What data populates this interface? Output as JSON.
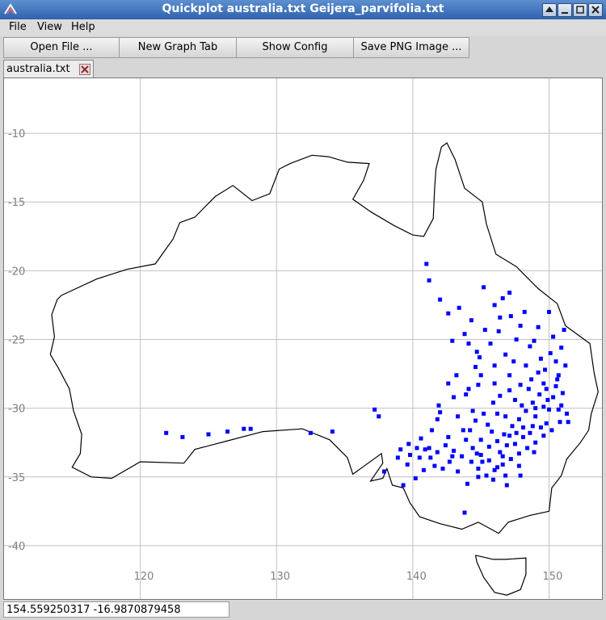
{
  "window": {
    "title": "Quickplot australia.txt Geijera_parvifolia.txt"
  },
  "menu": [
    "File",
    "View",
    "Help"
  ],
  "toolbar": {
    "open_file": "Open File ...",
    "new_graph_tab": "New Graph Tab",
    "show_config": "Show Config",
    "save_png": "Save PNG Image ..."
  },
  "tab": {
    "label": "australia.txt"
  },
  "status": {
    "coords": "154.559250317  -16.9870879458"
  },
  "colors": {
    "points": "#0000ff",
    "outline": "#000000",
    "grid": "#c0c0c0",
    "tick_text": "#808080"
  },
  "chart_data": {
    "type": "scatter",
    "xlim": [
      110,
      154
    ],
    "ylim": [
      -44,
      -6
    ],
    "xticks": [
      120,
      130,
      140,
      150
    ],
    "xtick_labels": [
      "120",
      "130",
      "140",
      "150"
    ],
    "yticks": [
      -10,
      -15,
      -20,
      -25,
      -30,
      -35,
      -40
    ],
    "ytick_labels": [
      "-10",
      "-15",
      "-20",
      "-25",
      "-30",
      "-35",
      "-40"
    ],
    "grid": true,
    "series": [
      {
        "marker": "outline-line",
        "points": [
          [
            114.2,
            -21.8
          ],
          [
            116.8,
            -20.6
          ],
          [
            119.0,
            -19.9
          ],
          [
            121.1,
            -19.5
          ],
          [
            122.4,
            -17.7
          ],
          [
            122.9,
            -16.5
          ],
          [
            124.0,
            -16.1
          ],
          [
            125.5,
            -14.6
          ],
          [
            126.8,
            -13.8
          ],
          [
            128.2,
            -14.9
          ],
          [
            129.5,
            -14.4
          ],
          [
            130.2,
            -12.6
          ],
          [
            131.0,
            -12.2
          ],
          [
            132.6,
            -11.6
          ],
          [
            133.8,
            -11.7
          ],
          [
            135.2,
            -12.1
          ],
          [
            136.8,
            -12.2
          ],
          [
            136.4,
            -13.4
          ],
          [
            135.6,
            -14.8
          ],
          [
            136.9,
            -15.7
          ],
          [
            138.6,
            -16.7
          ],
          [
            140.0,
            -17.4
          ],
          [
            140.8,
            -17.5
          ],
          [
            141.5,
            -16.2
          ],
          [
            141.6,
            -14.0
          ],
          [
            141.7,
            -12.6
          ],
          [
            142.1,
            -11.0
          ],
          [
            142.5,
            -10.7
          ],
          [
            143.1,
            -11.9
          ],
          [
            143.8,
            -14.0
          ],
          [
            145.1,
            -15.0
          ],
          [
            145.4,
            -16.6
          ],
          [
            146.1,
            -18.8
          ],
          [
            147.6,
            -19.7
          ],
          [
            149.2,
            -21.3
          ],
          [
            150.6,
            -22.4
          ],
          [
            151.2,
            -24.0
          ],
          [
            153.0,
            -25.3
          ],
          [
            153.3,
            -27.4
          ],
          [
            153.6,
            -28.8
          ],
          [
            153.1,
            -30.4
          ],
          [
            152.9,
            -31.6
          ],
          [
            152.3,
            -32.5
          ],
          [
            151.3,
            -33.7
          ],
          [
            150.9,
            -34.9
          ],
          [
            150.2,
            -35.8
          ],
          [
            150.0,
            -37.5
          ],
          [
            148.6,
            -37.8
          ],
          [
            147.0,
            -38.3
          ],
          [
            146.3,
            -39.1
          ],
          [
            144.8,
            -38.3
          ],
          [
            143.6,
            -38.8
          ],
          [
            142.0,
            -38.4
          ],
          [
            140.5,
            -37.9
          ],
          [
            139.8,
            -36.9
          ],
          [
            139.3,
            -35.8
          ],
          [
            138.5,
            -35.6
          ],
          [
            138.1,
            -34.4
          ],
          [
            137.8,
            -35.1
          ],
          [
            136.9,
            -35.3
          ],
          [
            137.8,
            -34.0
          ],
          [
            137.7,
            -33.3
          ],
          [
            136.3,
            -34.3
          ],
          [
            135.6,
            -34.8
          ],
          [
            135.2,
            -33.6
          ],
          [
            133.9,
            -32.3
          ],
          [
            131.9,
            -31.5
          ],
          [
            129.0,
            -31.7
          ],
          [
            126.3,
            -32.4
          ],
          [
            124.0,
            -33.0
          ],
          [
            123.2,
            -34.0
          ],
          [
            120.0,
            -33.9
          ],
          [
            117.9,
            -35.1
          ],
          [
            116.4,
            -35.0
          ],
          [
            115.0,
            -34.3
          ],
          [
            115.6,
            -33.3
          ],
          [
            115.7,
            -31.9
          ],
          [
            115.1,
            -30.2
          ],
          [
            114.8,
            -28.6
          ],
          [
            114.0,
            -27.1
          ],
          [
            113.4,
            -26.1
          ],
          [
            113.7,
            -24.8
          ],
          [
            113.5,
            -23.2
          ],
          [
            113.9,
            -22.1
          ],
          [
            114.2,
            -21.8
          ]
        ]
      },
      {
        "marker": "outline-line",
        "points": [
          [
            144.6,
            -40.7
          ],
          [
            145.9,
            -41.0
          ],
          [
            146.8,
            -41.0
          ],
          [
            148.3,
            -40.9
          ],
          [
            148.3,
            -42.1
          ],
          [
            147.9,
            -43.2
          ],
          [
            146.9,
            -43.6
          ],
          [
            146.0,
            -43.4
          ],
          [
            145.2,
            -42.3
          ],
          [
            144.7,
            -41.2
          ],
          [
            144.6,
            -40.7
          ]
        ]
      },
      {
        "marker": "square",
        "points": [
          [
            121.9,
            -31.8
          ],
          [
            123.1,
            -32.1
          ],
          [
            125.0,
            -31.9
          ],
          [
            126.4,
            -31.7
          ],
          [
            127.6,
            -31.5
          ],
          [
            128.1,
            -31.5
          ],
          [
            132.5,
            -31.8
          ],
          [
            134.1,
            -31.7
          ],
          [
            137.2,
            -30.1
          ],
          [
            137.5,
            -30.6
          ],
          [
            141.0,
            -19.5
          ],
          [
            141.2,
            -20.7
          ],
          [
            142.0,
            -22.1
          ],
          [
            142.6,
            -23.1
          ],
          [
            143.4,
            -22.7
          ],
          [
            144.3,
            -23.6
          ],
          [
            145.2,
            -21.2
          ],
          [
            146.0,
            -22.5
          ],
          [
            146.6,
            -22.0
          ],
          [
            147.2,
            -23.3
          ],
          [
            147.9,
            -24.0
          ],
          [
            146.3,
            -24.4
          ],
          [
            143.8,
            -24.6
          ],
          [
            142.9,
            -25.1
          ],
          [
            144.7,
            -25.9
          ],
          [
            145.7,
            -25.3
          ],
          [
            146.8,
            -26.1
          ],
          [
            147.6,
            -25.0
          ],
          [
            148.6,
            -25.5
          ],
          [
            149.4,
            -26.4
          ],
          [
            150.3,
            -24.8
          ],
          [
            150.9,
            -25.6
          ],
          [
            151.2,
            -26.9
          ],
          [
            150.7,
            -27.6
          ],
          [
            149.7,
            -27.2
          ],
          [
            148.7,
            -27.9
          ],
          [
            147.9,
            -28.3
          ],
          [
            147.1,
            -28.7
          ],
          [
            146.4,
            -29.1
          ],
          [
            145.9,
            -29.6
          ],
          [
            145.2,
            -30.4
          ],
          [
            144.6,
            -30.9
          ],
          [
            144.2,
            -31.6
          ],
          [
            143.9,
            -32.3
          ],
          [
            144.4,
            -32.9
          ],
          [
            145.0,
            -33.4
          ],
          [
            145.6,
            -32.8
          ],
          [
            146.2,
            -32.4
          ],
          [
            146.7,
            -31.9
          ],
          [
            147.3,
            -31.3
          ],
          [
            147.8,
            -30.8
          ],
          [
            148.3,
            -30.2
          ],
          [
            148.8,
            -29.6
          ],
          [
            149.3,
            -29.0
          ],
          [
            149.8,
            -28.6
          ],
          [
            150.3,
            -29.2
          ],
          [
            150.9,
            -29.8
          ],
          [
            151.3,
            -30.4
          ],
          [
            150.8,
            -31.0
          ],
          [
            150.2,
            -31.6
          ],
          [
            149.6,
            -32.0
          ],
          [
            149.0,
            -32.5
          ],
          [
            148.4,
            -32.9
          ],
          [
            147.8,
            -33.3
          ],
          [
            147.2,
            -33.7
          ],
          [
            146.6,
            -34.1
          ],
          [
            146.0,
            -34.5
          ],
          [
            145.4,
            -34.9
          ],
          [
            144.8,
            -34.4
          ],
          [
            144.3,
            -33.9
          ],
          [
            143.6,
            -33.5
          ],
          [
            143.0,
            -33.1
          ],
          [
            142.4,
            -32.7
          ],
          [
            141.8,
            -33.2
          ],
          [
            141.3,
            -33.6
          ],
          [
            140.9,
            -33.0
          ],
          [
            140.3,
            -32.9
          ],
          [
            139.7,
            -32.6
          ],
          [
            139.1,
            -33.0
          ],
          [
            141.6,
            -34.2
          ],
          [
            142.2,
            -34.4
          ],
          [
            141.8,
            -30.8
          ],
          [
            141.9,
            -29.8
          ],
          [
            144.1,
            -28.6
          ],
          [
            144.8,
            -28.3
          ],
          [
            142.6,
            -28.2
          ],
          [
            143.2,
            -27.6
          ],
          [
            144.6,
            -27.0
          ],
          [
            148.2,
            -23.0
          ],
          [
            147.1,
            -21.6
          ],
          [
            149.2,
            -24.1
          ],
          [
            148.3,
            -26.9
          ],
          [
            150.6,
            -27.9
          ],
          [
            149.0,
            -30.6
          ],
          [
            147.6,
            -31.8
          ],
          [
            146.2,
            -30.4
          ],
          [
            145.5,
            -31.2
          ],
          [
            146.9,
            -32.7
          ],
          [
            148.8,
            -31.3
          ],
          [
            150.0,
            -30.1
          ],
          [
            149.4,
            -31.4
          ],
          [
            148.1,
            -32.1
          ],
          [
            146.4,
            -33.2
          ],
          [
            145.1,
            -33.9
          ],
          [
            144.0,
            -35.5
          ],
          [
            137.9,
            -34.6
          ],
          [
            139.3,
            -35.6
          ],
          [
            142.7,
            -33.9
          ],
          [
            140.8,
            -34.5
          ],
          [
            140.2,
            -35.1
          ],
          [
            139.6,
            -34.1
          ],
          [
            143.3,
            -34.6
          ],
          [
            147.5,
            -29.4
          ],
          [
            146.8,
            -30.6
          ],
          [
            145.8,
            -31.7
          ],
          [
            145.0,
            -32.3
          ],
          [
            144.7,
            -33.3
          ],
          [
            146.2,
            -34.3
          ],
          [
            147.1,
            -32.0
          ],
          [
            148.1,
            -31.4
          ],
          [
            149.0,
            -30.0
          ],
          [
            149.9,
            -29.4
          ],
          [
            150.5,
            -28.4
          ],
          [
            151.0,
            -28.9
          ],
          [
            150.1,
            -26.0
          ],
          [
            151.1,
            -24.3
          ],
          [
            146.4,
            -23.4
          ],
          [
            143.0,
            -29.2
          ],
          [
            142.0,
            -30.3
          ],
          [
            140.6,
            -32.2
          ],
          [
            138.9,
            -33.6
          ],
          [
            141.4,
            -31.6
          ],
          [
            143.3,
            -30.6
          ],
          [
            144.4,
            -30.2
          ],
          [
            146.0,
            -28.2
          ],
          [
            147.1,
            -27.6
          ],
          [
            148.5,
            -28.6
          ],
          [
            149.6,
            -29.9
          ],
          [
            150.7,
            -30.1
          ],
          [
            151.4,
            -31.0
          ],
          [
            149.8,
            -31.1
          ],
          [
            148.6,
            -31.8
          ],
          [
            147.5,
            -32.6
          ],
          [
            146.6,
            -33.5
          ],
          [
            145.6,
            -33.8
          ],
          [
            144.8,
            -35.0
          ],
          [
            145.9,
            -35.2
          ],
          [
            146.8,
            -34.9
          ],
          [
            147.8,
            -34.2
          ],
          [
            143.7,
            -31.6
          ],
          [
            142.6,
            -32.1
          ],
          [
            148.9,
            -25.1
          ],
          [
            150.0,
            -23.0
          ],
          [
            145.3,
            -24.3
          ],
          [
            144.1,
            -25.3
          ],
          [
            145.0,
            -27.6
          ],
          [
            143.9,
            -29.0
          ],
          [
            142.9,
            -33.5
          ],
          [
            141.2,
            -32.9
          ],
          [
            140.5,
            -33.6
          ],
          [
            139.8,
            -33.4
          ],
          [
            149.2,
            -27.4
          ],
          [
            147.4,
            -26.6
          ],
          [
            146.0,
            -26.9
          ],
          [
            144.9,
            -26.3
          ],
          [
            150.5,
            -26.6
          ],
          [
            148.9,
            -33.2
          ],
          [
            147.9,
            -34.9
          ],
          [
            146.9,
            -35.6
          ],
          [
            143.8,
            -37.6
          ],
          [
            148.0,
            -29.8
          ],
          [
            149.6,
            -28.2
          ]
        ]
      }
    ]
  }
}
